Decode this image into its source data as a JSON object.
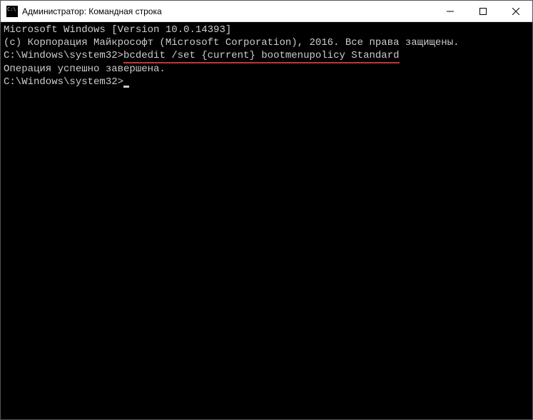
{
  "window": {
    "title": "Администратор: Командная строка"
  },
  "terminal": {
    "line1": "Microsoft Windows [Version 10.0.14393]",
    "line2": "(c) Корпорация Майкрософт (Microsoft Corporation), 2016. Все права защищены.",
    "blank1": "",
    "prompt1_prefix": "C:\\Windows\\system32>",
    "prompt1_command": "bcdedit /set {current} bootmenupolicy Standard",
    "result1": "Операция успешно завершена.",
    "blank2": "",
    "prompt2_prefix": "C:\\Windows\\system32>"
  }
}
